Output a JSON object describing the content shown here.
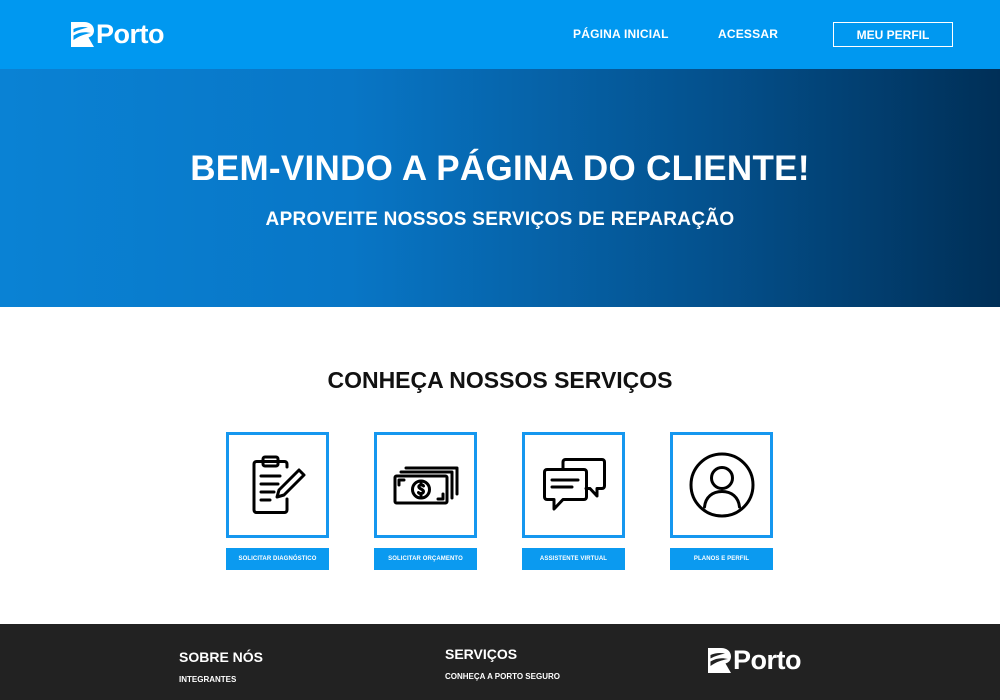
{
  "brand": {
    "name": "Porto",
    "primary_color": "#0098f0",
    "footer_color": "#222222"
  },
  "nav": {
    "home_label": "PÁGINA INICIAL",
    "access_label": "ACESSAR",
    "profile_label": "MEU PERFIL"
  },
  "hero": {
    "title": "BEM-VINDO A PÁGINA DO CLIENTE!",
    "subtitle": "APROVEITE NOSSOS SERVIÇOS DE REPARAÇÃO"
  },
  "services": {
    "title": "CONHEÇA NOSSOS SERVIÇOS",
    "items": [
      {
        "icon": "clipboard-edit-icon",
        "label": "SOLICITAR DIAGNÓSTICO"
      },
      {
        "icon": "money-bills-icon",
        "label": "SOLICITAR ORÇAMENTO"
      },
      {
        "icon": "chat-bubbles-icon",
        "label": "ASSISTENTE VIRTUAL"
      },
      {
        "icon": "user-circle-icon",
        "label": "PLANOS E PERFIL"
      }
    ]
  },
  "footer": {
    "about_heading": "SOBRE NÓS",
    "about_link": "INTEGRANTES",
    "services_heading": "SERVIÇOS",
    "services_link": "CONHEÇA A PORTO SEGURO"
  }
}
